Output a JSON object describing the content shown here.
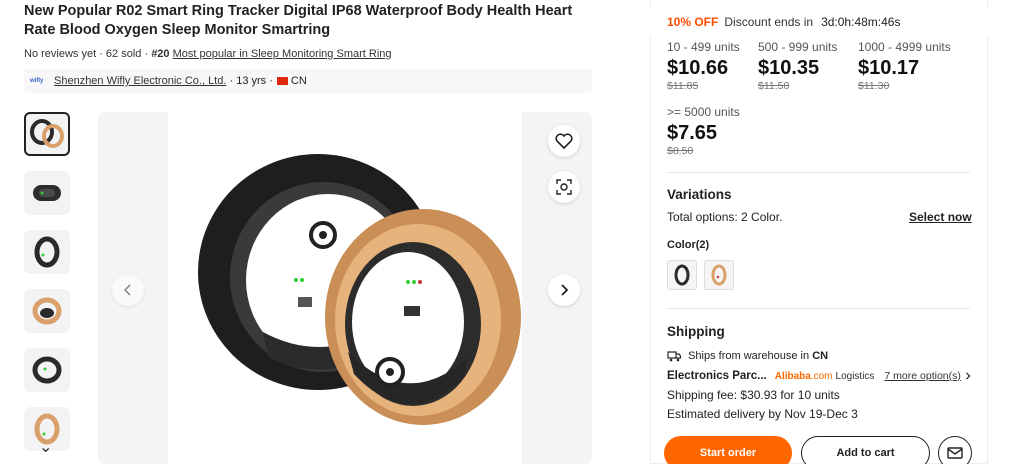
{
  "product": {
    "title": "New Popular R02 Smart Ring Tracker Digital IP68 Waterproof Body Health Heart Rate Blood Oxygen Sleep Monitor Smartring",
    "reviews": "No reviews yet",
    "sold": "62 sold",
    "rank": "#20",
    "rank_link": "Most popular in Sleep Monitoring Smart Ring"
  },
  "supplier": {
    "logo_text": "wifly",
    "name": "Shenzhen Wifly Electronic Co., Ltd.",
    "years": "13 yrs",
    "country": "CN"
  },
  "gallery": {
    "thumbnails": [
      "thumb-pair",
      "thumb-black-side",
      "thumb-black-front",
      "thumb-gold",
      "thumb-black-angle",
      "thumb-gold-front"
    ],
    "selected_index": 0
  },
  "deal": {
    "discount": "10% OFF",
    "label": "Discount ends in",
    "countdown": "3d:0h:48m:46s"
  },
  "tiers": [
    {
      "qty": "10 - 499 units",
      "price": "$10.66",
      "old": "$11.85"
    },
    {
      "qty": "500 - 999 units",
      "price": "$10.35",
      "old": "$11.50"
    },
    {
      "qty": "1000 - 4999 units",
      "price": "$10.17",
      "old": "$11.30"
    },
    {
      "qty": ">= 5000 units",
      "price": "$7.65",
      "old": "$8.50"
    }
  ],
  "variations": {
    "title": "Variations",
    "total": "Total options: 2 Color.",
    "select_now": "Select now",
    "color_label": "Color(2)",
    "colors": [
      "black",
      "gold"
    ]
  },
  "shipping": {
    "title": "Shipping",
    "ships_from_prefix": "Ships from warehouse in",
    "ships_from_country": "CN",
    "method_name": "Electronics Parc...",
    "carrier_brand": "Alibaba",
    "carrier_suffix": ".com",
    "carrier_label": "Logistics",
    "more_options": "7 more option(s)",
    "fee": "Shipping fee: $30.93 for 10 units",
    "estimate": "Estimated delivery by Nov 19-Dec 3"
  },
  "actions": {
    "start_order": "Start order",
    "add_to_cart": "Add to cart"
  },
  "colors": {
    "accent": "#ff6600",
    "discount": "#ff4d00",
    "gold": "#d9a06b",
    "black_ring": "#2a2a2a"
  }
}
